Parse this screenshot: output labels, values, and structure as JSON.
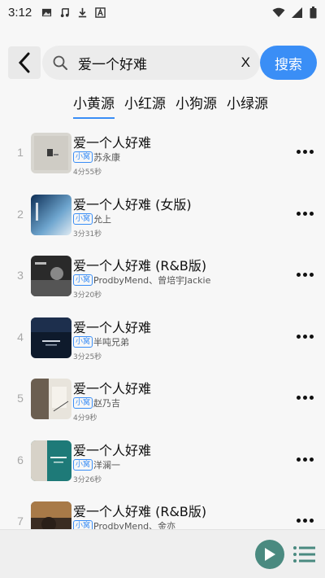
{
  "status_bar": {
    "time": "3:12",
    "left_icons": [
      "image-icon",
      "music-note-icon",
      "download-icon",
      "a-box-icon"
    ],
    "right_icons": [
      "wifi-icon",
      "signal-icon",
      "battery-icon"
    ]
  },
  "search": {
    "query": "爱一个好难",
    "clear_label": "X",
    "button_label": "搜索"
  },
  "tabs": [
    {
      "label": "小黄源",
      "active": true
    },
    {
      "label": "小红源",
      "active": false
    },
    {
      "label": "小狗源",
      "active": false
    },
    {
      "label": "小绿源",
      "active": false
    }
  ],
  "songs": [
    {
      "index": "1",
      "title": "爱一个人好难",
      "badge": "小窝",
      "artist": "苏永康",
      "duration": "4分55秒"
    },
    {
      "index": "2",
      "title": "爱一个人好难 (女版)",
      "badge": "小窝",
      "artist": "允上",
      "duration": "3分31秒"
    },
    {
      "index": "3",
      "title": "爱一个人好难 (R&B版)",
      "badge": "小窝",
      "artist": "ProdbyMend、曾培宇Jackie",
      "duration": "3分20秒"
    },
    {
      "index": "4",
      "title": "爱一个人好难",
      "badge": "小窝",
      "artist": "半吨兄弟",
      "duration": "3分25秒"
    },
    {
      "index": "5",
      "title": "爱一个人好难",
      "badge": "小窝",
      "artist": "赵乃吉",
      "duration": "4分9秒"
    },
    {
      "index": "6",
      "title": "爱一个人好难",
      "badge": "小窝",
      "artist": "洋澜一",
      "duration": "3分26秒"
    },
    {
      "index": "7",
      "title": "爱一个人好难 (R&B版)",
      "badge": "小窝",
      "artist": "ProdbyMend、金亦",
      "duration": ""
    }
  ],
  "colors": {
    "accent": "#3a8ef6",
    "play_button": "#4a8a80"
  }
}
